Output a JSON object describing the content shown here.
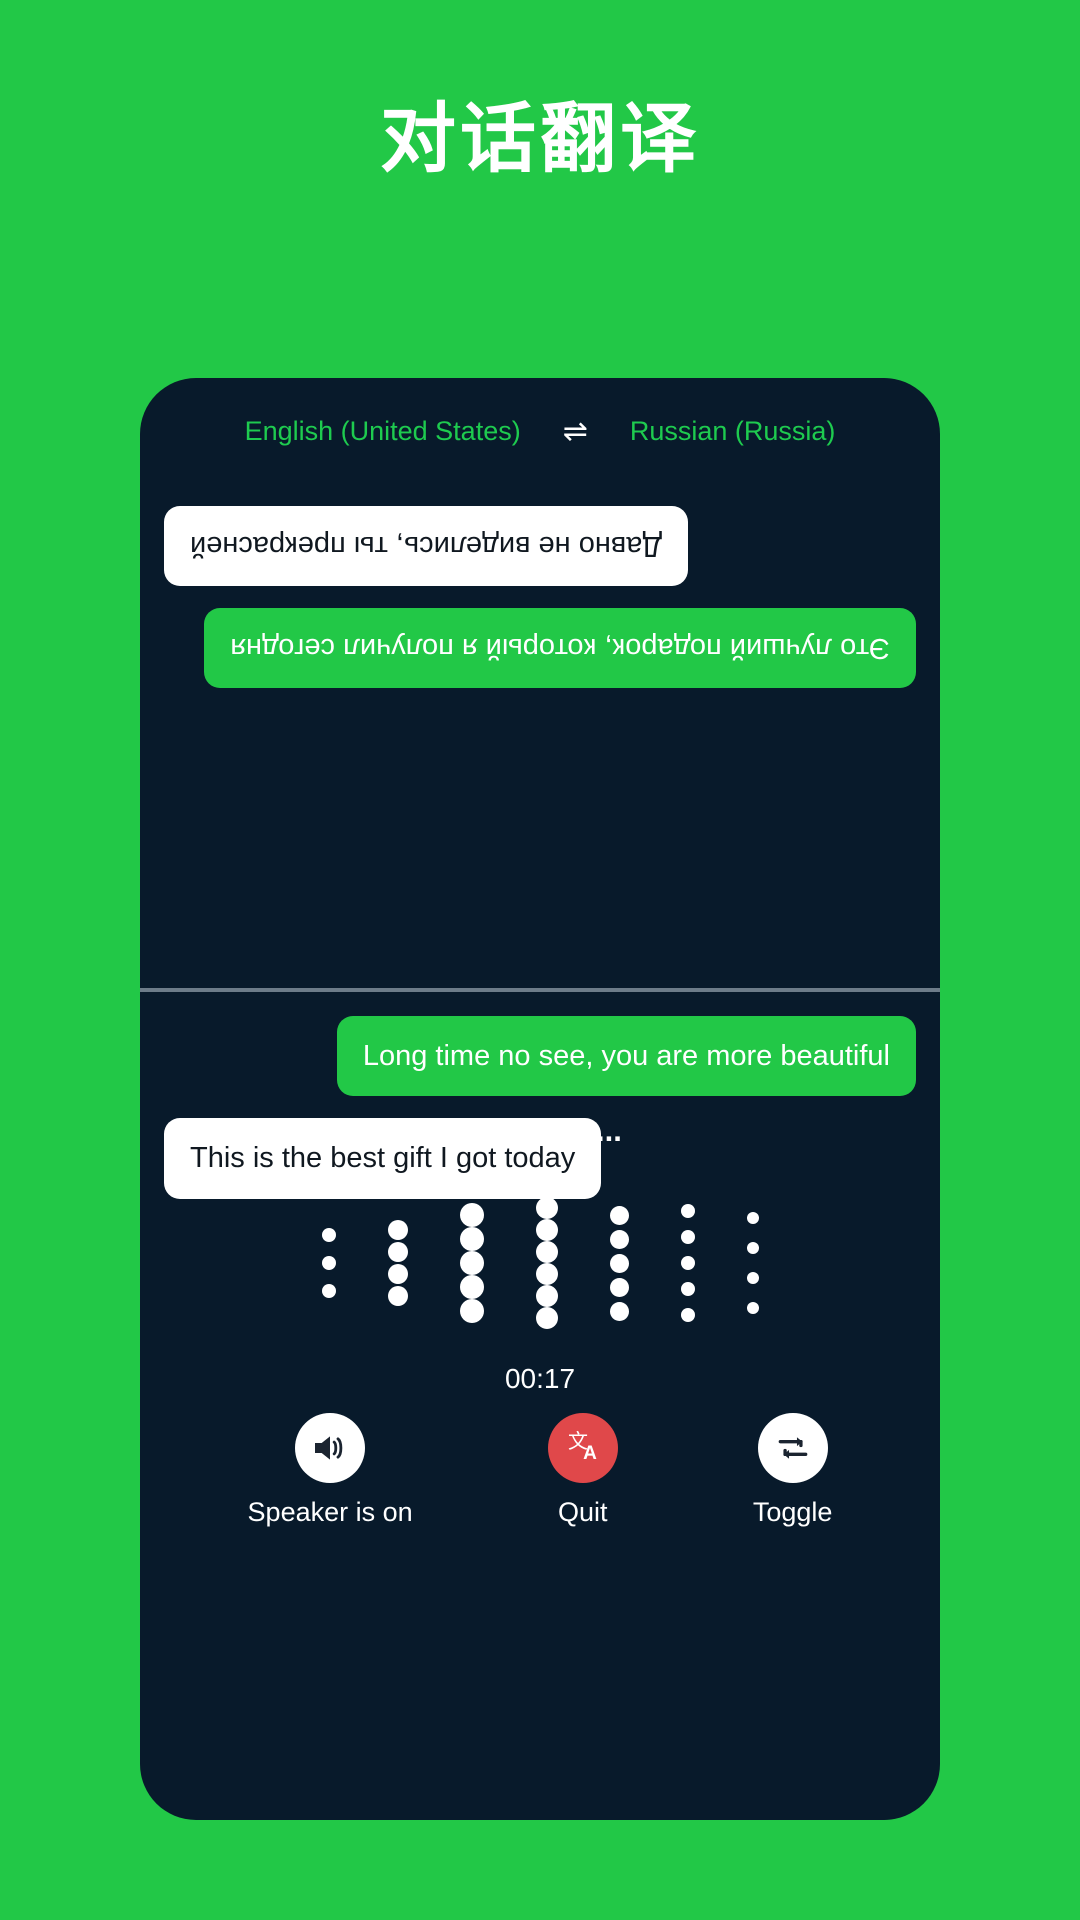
{
  "page": {
    "title": "对话翻译",
    "background_color": "#22c847"
  },
  "phone": {
    "background_color": "#081a2b",
    "language_bar": {
      "source_language": "English (United States)",
      "swap_icon": "swap-horizontal-icon",
      "swap_glyph": "⇌",
      "target_language": "Russian (Russia)",
      "text_color": "#1ecb4f"
    },
    "conversation": {
      "translated_panel_rotated": true,
      "translated_messages": [
        {
          "text": "Это лучший подарок, который я получил сегодня",
          "align": "left",
          "style": "green"
        },
        {
          "text": "Давно не виделись, ты прекрасней",
          "align": "right",
          "style": "white"
        }
      ],
      "source_messages": [
        {
          "text": "Long time no see, you are more beautiful",
          "align": "right",
          "style": "green"
        },
        {
          "text": "This is the best gift I got today",
          "align": "left",
          "style": "white"
        }
      ],
      "bubble_colors": {
        "green": "#22c847",
        "white": "#ffffff",
        "green_text": "#ffffff",
        "white_text": "#101820"
      }
    },
    "status": {
      "listening_label": "Listening...",
      "timer": "00:17"
    },
    "waveform": {
      "dot_color": "#ffffff",
      "columns": [
        {
          "count": 3,
          "size": 14,
          "gap": 28
        },
        {
          "count": 4,
          "size": 20,
          "gap": 22
        },
        {
          "count": 5,
          "size": 24,
          "gap": 22
        },
        {
          "count": 6,
          "size": 22,
          "gap": 20
        },
        {
          "count": 5,
          "size": 19,
          "gap": 24
        },
        {
          "count": 5,
          "size": 14,
          "gap": 26
        },
        {
          "count": 4,
          "size": 12,
          "gap": 30
        }
      ]
    },
    "controls": [
      {
        "label": "Speaker is on",
        "icon": "speaker-on-icon",
        "circle_color": "#ffffff",
        "icon_color": "#1b2430"
      },
      {
        "label": "Quit",
        "icon": "translate-icon",
        "circle_color": "#e0484a",
        "icon_color": "#ffffff"
      },
      {
        "label": "Toggle",
        "icon": "repeat-arrows-icon",
        "circle_color": "#ffffff",
        "icon_color": "#1b2430"
      }
    ]
  }
}
